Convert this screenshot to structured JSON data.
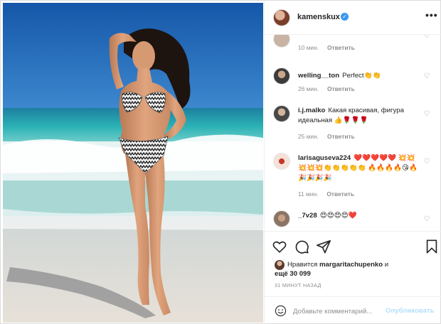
{
  "post": {
    "username": "kamenskux",
    "verified_icon": "verified-badge-icon",
    "more_icon": "more-options-icon"
  },
  "comments": [
    {
      "username": "",
      "text": "",
      "time": "10 мин.",
      "reply": "Ответить",
      "partial": true
    },
    {
      "username": "welling__ton",
      "text": "Perfect👏👏",
      "time": "26 мин.",
      "reply": "Ответить"
    },
    {
      "username": "i.j.malko",
      "text": "Какая красивая, фигура идеальная 👍🌹🌹🌹",
      "time": "25 мин.",
      "reply": "Ответить"
    },
    {
      "username": "larisaguseva224",
      "text": "❤️❤️❤️❤️❤️ 💥💥💥💥💥👏👏👏👏👏 🔥🔥🔥🔥😘🔥🎉🎉🎉🎉",
      "time": "11 мин.",
      "reply": "Ответить"
    },
    {
      "username": "_7v28",
      "text": "😍😍😍😍❤️",
      "time": "",
      "reply": ""
    }
  ],
  "actions": {
    "like_icon": "heart-icon",
    "comment_icon": "comment-icon",
    "share_icon": "send-icon",
    "save_icon": "bookmark-icon"
  },
  "likes": {
    "prefix": "Нравится",
    "user": "margaritachupenko",
    "and": "и",
    "others": "ещё 30 099"
  },
  "timestamp": "31 МИНУТ НАЗАД",
  "add_comment": {
    "placeholder": "Добавьте комментарий...",
    "post_label": "Опубликовать"
  },
  "colors": {
    "text": "#262626",
    "muted": "#8e8e8e",
    "verified": "#3897f0",
    "post_disabled": "#b2dffc",
    "border": "#efefef"
  }
}
